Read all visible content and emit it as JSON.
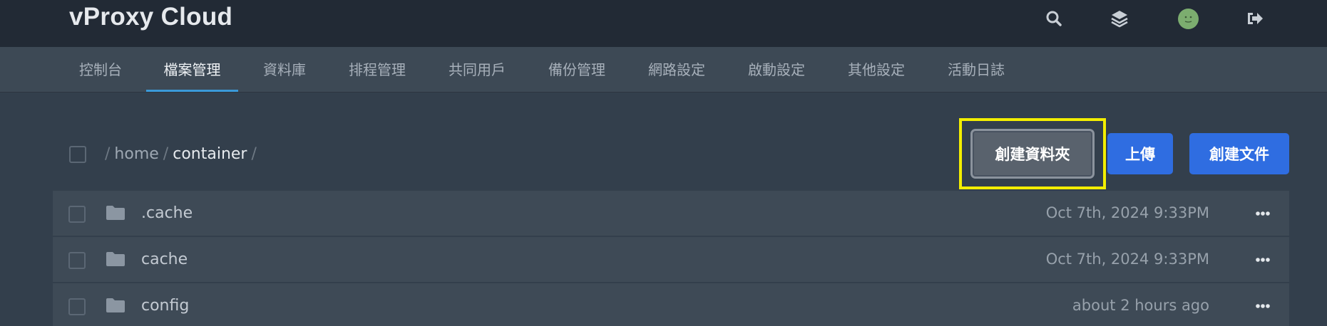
{
  "header": {
    "brand": "vProxy Cloud",
    "icons": [
      "search-icon",
      "layers-icon",
      "avatar",
      "logout-icon"
    ]
  },
  "nav": {
    "tabs": [
      {
        "label": "控制台",
        "active": false
      },
      {
        "label": "檔案管理",
        "active": true
      },
      {
        "label": "資料庫",
        "active": false
      },
      {
        "label": "排程管理",
        "active": false
      },
      {
        "label": "共同用戶",
        "active": false
      },
      {
        "label": "備份管理",
        "active": false
      },
      {
        "label": "網路設定",
        "active": false
      },
      {
        "label": "啟動設定",
        "active": false
      },
      {
        "label": "其他設定",
        "active": false
      },
      {
        "label": "活動日誌",
        "active": false
      }
    ],
    "accent": "#3b9ad9"
  },
  "breadcrumb": {
    "parts": [
      "home",
      "container"
    ],
    "separator": "/"
  },
  "actions": {
    "create_folder": "創建資料夾",
    "upload": "上傳",
    "create_file": "創建文件",
    "primary_color": "#2f6de1",
    "highlight_color": "#f3ee00"
  },
  "files": [
    {
      "name": ".cache",
      "modified": "Oct 7th, 2024 9:33PM",
      "type": "folder"
    },
    {
      "name": "cache",
      "modified": "Oct 7th, 2024 9:33PM",
      "type": "folder"
    },
    {
      "name": "config",
      "modified": "about 2 hours ago",
      "type": "folder"
    }
  ]
}
